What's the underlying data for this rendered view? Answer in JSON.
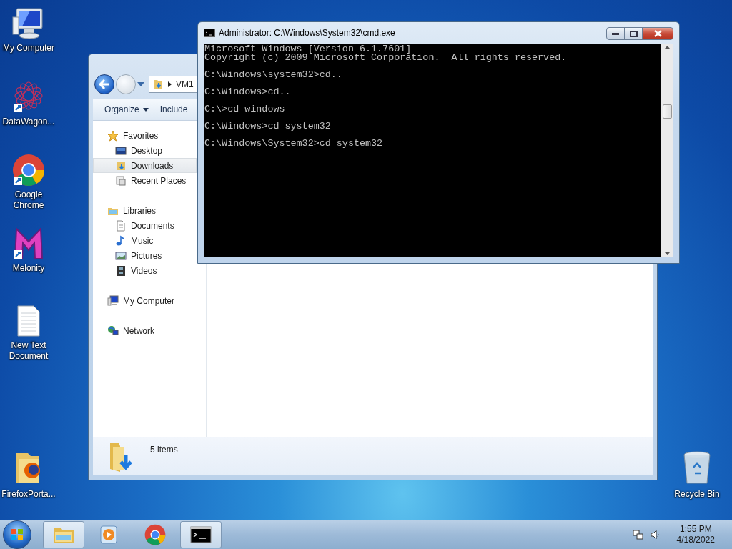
{
  "desktop_icons": [
    {
      "kind": "computer",
      "label": "My Computer"
    },
    {
      "kind": "datawagon",
      "label": "DataWagon..."
    },
    {
      "kind": "chrome",
      "label": "Google Chrome"
    },
    {
      "kind": "melonity",
      "label": "Melonity"
    },
    {
      "kind": "textfile",
      "label": "New Text Document"
    },
    {
      "kind": "firefoxfolder",
      "label": "FirefoxPorta..."
    },
    {
      "kind": "recyclebin",
      "label": "Recycle Bin"
    }
  ],
  "explorer": {
    "breadcrumb": "VM1",
    "toolbar": [
      {
        "label": "Organize",
        "dropdown": true
      },
      {
        "label": "Include",
        "dropdown": false
      }
    ],
    "nav": [
      {
        "kind": "star",
        "label": "Favorites",
        "selected": false,
        "children": [
          {
            "kind": "desktop",
            "label": "Desktop",
            "selected": false
          },
          {
            "kind": "downloads",
            "label": "Downloads",
            "selected": true
          },
          {
            "kind": "recent",
            "label": "Recent Places",
            "selected": false
          }
        ]
      },
      {
        "kind": "library",
        "label": "Libraries",
        "selected": false,
        "children": [
          {
            "kind": "document",
            "label": "Documents",
            "selected": false
          },
          {
            "kind": "music",
            "label": "Music",
            "selected": false
          },
          {
            "kind": "pictures",
            "label": "Pictures",
            "selected": false
          },
          {
            "kind": "videos",
            "label": "Videos",
            "selected": false
          }
        ]
      },
      {
        "kind": "computer",
        "label": "My Computer",
        "selected": false
      },
      {
        "kind": "network",
        "label": "Network",
        "selected": false
      }
    ],
    "status": "5 items"
  },
  "console": {
    "title": "Administrator: C:\\Windows\\System32\\cmd.exe",
    "lines": [
      "Microsoft Windows [Version 6.1.7601]",
      "Copyright (c) 2009 Microsoft Corporation.  All rights reserved.",
      "C:\\Windows\\system32>cd..",
      "C:\\Windows>cd..",
      "C:\\>cd windows",
      "C:\\Windows>cd system32",
      "C:\\Windows\\System32>cd system32"
    ]
  },
  "taskbar": {
    "apps": [
      {
        "kind": "explorer",
        "running": true
      },
      {
        "kind": "media",
        "running": false
      },
      {
        "kind": "chrome",
        "running": false
      },
      {
        "kind": "console",
        "running": true
      }
    ],
    "time": "1:55 PM",
    "date": "4/18/2022"
  }
}
